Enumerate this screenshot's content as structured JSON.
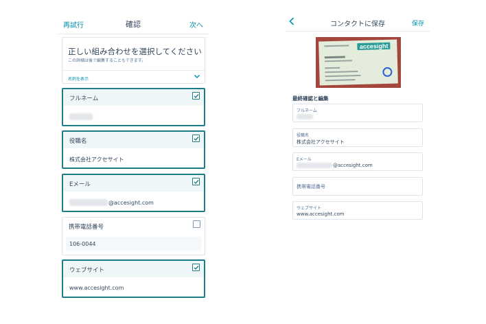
{
  "left_screen": {
    "header": {
      "retry": "再試行",
      "title": "確認",
      "next": "次へ"
    },
    "combo": {
      "title": "正しい組み合わせを選択してください",
      "subtitle": "この詳細は後で編集することもできます。",
      "show_card": "名刺を表示"
    },
    "cards": [
      {
        "label": "フルネーム",
        "value": "",
        "checked": true
      },
      {
        "label": "役職名",
        "value": "株式会社アクセサイト",
        "checked": true
      },
      {
        "label": "Eメール",
        "value": "@accesight.com",
        "checked": true
      },
      {
        "label": "携帯電話番号",
        "value": "106-0044",
        "checked": false
      },
      {
        "label": "ウェブサイト",
        "value": "www.accesight.com",
        "checked": true
      }
    ]
  },
  "right_screen": {
    "header": {
      "title": "コンタクトに保存",
      "save": "保存"
    },
    "business_card": {
      "logo_text": "accesight"
    },
    "section_title": "最終確認と編集",
    "fields": [
      {
        "label": "フルネーム",
        "value": ""
      },
      {
        "label": "役職名",
        "value": "株式会社アクセサイト"
      },
      {
        "label": "Eメール",
        "value": "@accesight.com"
      },
      {
        "placeholder": "携帯電話番号"
      },
      {
        "label": "ウェブサイト",
        "value": "www.accesight.com"
      }
    ]
  },
  "colors": {
    "accent": "#0091ae",
    "selected_border": "#1d7d87",
    "card_red": "#a3463b"
  },
  "icons": [
    "chevron-down-icon",
    "checkbox-checked-icon",
    "checkbox-empty-icon",
    "back-chevron-icon",
    "redaction-blur"
  ]
}
